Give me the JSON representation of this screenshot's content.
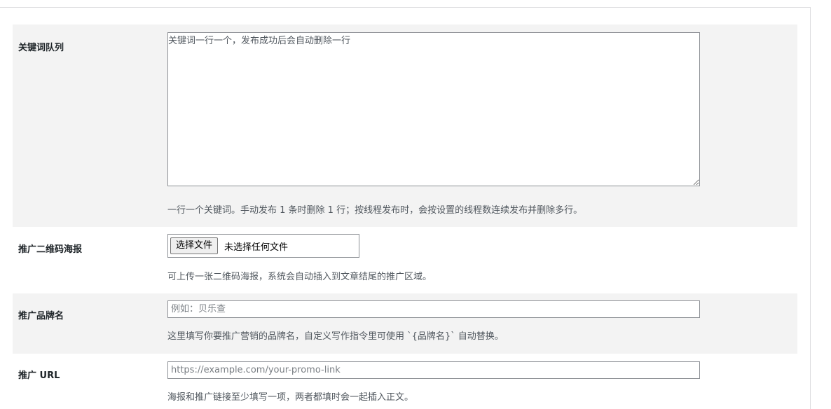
{
  "form": {
    "keywords": {
      "label": "关键词队列",
      "placeholder": "关键词一行一个，发布成功后会自动删除一行",
      "description": "一行一个关键词。手动发布 1 条时删除 1 行；按线程发布时，会按设置的线程数连续发布并删除多行。"
    },
    "poster": {
      "label": "推广二维码海报",
      "button_label": "选择文件",
      "file_status": "未选择任何文件",
      "description": "可上传一张二维码海报，系统会自动插入到文章结尾的推广区域。"
    },
    "brand": {
      "label": "推广品牌名",
      "placeholder": "例如：贝乐查",
      "description": "这里填写你要推广营销的品牌名，自定义写作指令里可使用 `{品牌名}` 自动替换。"
    },
    "url": {
      "label": "推广 URL",
      "placeholder": "https://example.com/your-promo-link",
      "description": "海报和推广链接至少填写一项，两者都填时会一起插入正文。"
    }
  }
}
